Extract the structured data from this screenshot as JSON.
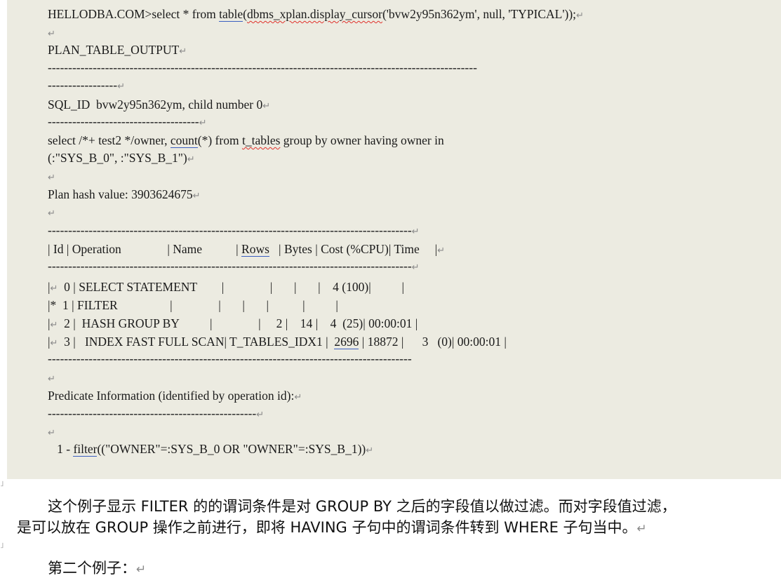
{
  "code": {
    "query_prefix": "HELLODBA.COM>select * from ",
    "query_fn1": "table",
    "query_fn2": "dbms_xplan.display_cursor",
    "query_args": "('bvw2y95n362ym', null, 'TYPICAL'));",
    "plan_table_output": "PLAN_TABLE_OUTPUT",
    "long_dash_1": "---------------------------------------------------------------------------------------------------------",
    "long_dash_2": "-----------------",
    "sql_id_label": "SQL_ID",
    "sql_id_value": "bvw2y95n362ym, child number 0",
    "sql_dash": "-------------------------------------",
    "stmt_a": "select /*+ test2 */owner, ",
    "stmt_count": "count",
    "stmt_b": "(*) from ",
    "stmt_table": "t_tables",
    "stmt_c": " group by owner having owner in",
    "stmt_line2": "(:\"SYS_B_0\", :\"SYS_B_1\")",
    "plan_hash": "Plan hash value: 3903624675",
    "table_dash": "-----------------------------------------------------------------------------------------",
    "predicate_title": "Predicate Information (identified by operation id):",
    "predicate_dash": "---------------------------------------------------",
    "predicate_prefix": "   1 - ",
    "predicate_fn": "filter",
    "predicate_body": "((\"OWNER\"=:SYS_B_0 OR \"OWNER\"=:SYS_B_1))"
  },
  "plan_table": {
    "headers": [
      "Id",
      "Operation",
      "Name",
      "Rows",
      "Bytes",
      "Cost (%CPU)",
      "Time"
    ],
    "rows": [
      {
        "flag": "↵",
        "id": "0",
        "operation": "SELECT STATEMENT",
        "name": "",
        "rows": "",
        "bytes": "",
        "cost": "4 (100)",
        "time": ""
      },
      {
        "flag": "*",
        "id": "1",
        "operation": " FILTER",
        "name": "",
        "rows": "",
        "bytes": "",
        "cost": "",
        "time": ""
      },
      {
        "flag": "↵",
        "id": "2",
        "operation": "  HASH GROUP BY",
        "name": "",
        "rows": "2",
        "bytes": "14",
        "cost": "4  (25)",
        "time": "00:00:01"
      },
      {
        "flag": "↵",
        "id": "3",
        "operation": "   INDEX FAST FULL SCAN",
        "name": "T_TABLES_IDX1",
        "rows": "2696",
        "bytes": "18872",
        "cost": "3   (0)",
        "time": "00:00:01"
      }
    ]
  },
  "paragraph": {
    "line1": "这个例子显示 FILTER 的的谓词条件是对 GROUP BY 之后的字段值以做过滤。而对字段值过滤，",
    "line2": "是可以放在 GROUP 操作之前进行，即将 HAVING 子句中的谓词条件转到 WHERE 子句当中。",
    "line3": "第二个例子："
  },
  "marks": {
    "para_mark": "↵"
  }
}
